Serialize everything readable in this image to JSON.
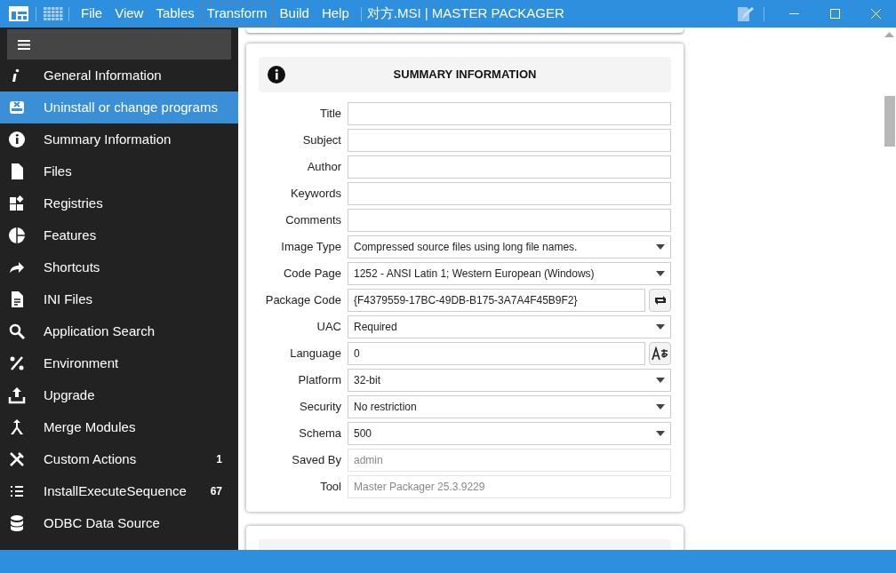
{
  "window": {
    "title": "对方.MSI | MASTER PACKAGER"
  },
  "menu": [
    {
      "label": "File",
      "selected": false
    },
    {
      "label": "View",
      "selected": false
    },
    {
      "label": "Tables",
      "selected": false
    },
    {
      "label": "Transform",
      "selected": true
    },
    {
      "label": "Build",
      "selected": false
    },
    {
      "label": "Help",
      "selected": false
    }
  ],
  "sidebar": {
    "items": [
      {
        "label": "General Information",
        "selected": false
      },
      {
        "label": "Uninstall or change programs",
        "selected": true
      },
      {
        "label": "Summary Information",
        "selected": false
      },
      {
        "label": "Files",
        "selected": false
      },
      {
        "label": "Registries",
        "selected": false
      },
      {
        "label": "Features",
        "selected": false
      },
      {
        "label": "Shortcuts",
        "selected": false
      },
      {
        "label": "INI Files",
        "selected": false
      },
      {
        "label": "Application Search",
        "selected": false
      },
      {
        "label": "Environment",
        "selected": false
      },
      {
        "label": "Upgrade",
        "selected": false
      },
      {
        "label": "Merge Modules",
        "selected": false
      },
      {
        "label": "Custom Actions",
        "selected": false,
        "count": "1"
      },
      {
        "label": "InstallExecuteSequence",
        "selected": false,
        "count": "67"
      },
      {
        "label": "ODBC Data Source",
        "selected": false
      }
    ]
  },
  "summary": {
    "title": "SUMMARY INFORMATION",
    "fields": [
      {
        "label": "Title",
        "kind": "text"
      },
      {
        "label": "Subject",
        "kind": "text"
      },
      {
        "label": "Author",
        "kind": "text"
      },
      {
        "label": "Keywords",
        "kind": "text"
      },
      {
        "label": "Comments",
        "kind": "text"
      },
      {
        "label": "Image Type",
        "kind": "select",
        "value": "Compressed source files using long file names."
      },
      {
        "label": "Code Page",
        "kind": "select",
        "value": "1252 - ANSI Latin 1; Western European (Windows)"
      },
      {
        "label": "Package Code",
        "kind": "regenerate",
        "value": "{F4379559-17BC-49DB-B175-3A7A4F45B9F2}"
      },
      {
        "label": "UAC",
        "kind": "select",
        "value": "Required"
      },
      {
        "label": "Language",
        "kind": "language",
        "value": "0"
      },
      {
        "label": "Platform",
        "kind": "select",
        "value": "32-bit"
      },
      {
        "label": "Security",
        "kind": "select",
        "value": "No restriction"
      },
      {
        "label": "Schema",
        "kind": "select",
        "value": "500"
      },
      {
        "label": "Saved By",
        "kind": "readonly",
        "value": "admin"
      },
      {
        "label": "Tool",
        "kind": "readonly",
        "value": "Master Packager 25.3.9229"
      }
    ]
  }
}
